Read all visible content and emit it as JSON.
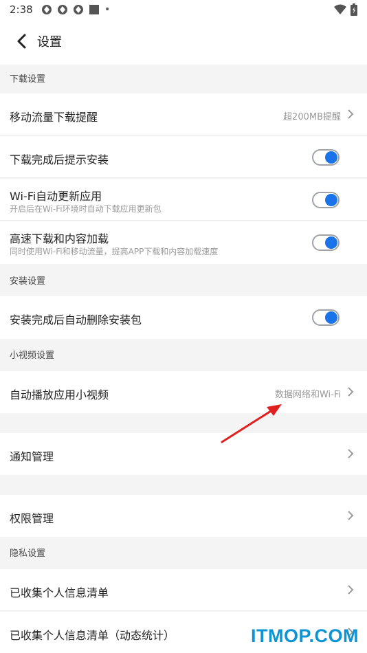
{
  "statusbar": {
    "time": "2:38",
    "dot": "•"
  },
  "appbar": {
    "title": "设置",
    "back_icon": "chevron-left-icon"
  },
  "sections": {
    "download": "下载设置",
    "install": "安装设置",
    "video": "小视频设置",
    "privacy": "隐私设置"
  },
  "rows": {
    "mobile_data": {
      "label": "移动流量下载提醒",
      "value": "超200MB提醒"
    },
    "install_prompt": {
      "label": "下载完成后提示安装",
      "toggle": true
    },
    "wifi_update": {
      "label": "Wi-Fi自动更新应用",
      "sub": "开启后在Wi-Fi环境时自动下载应用更新包",
      "toggle": true
    },
    "high_speed": {
      "label": "高速下载和内容加载",
      "sub": "同时使用Wi-Fi和移动流量，提高APP下载和内容加载速度",
      "toggle": true
    },
    "auto_delete": {
      "label": "安装完成后自动删除安装包",
      "toggle": true
    },
    "autoplay": {
      "label": "自动播放应用小视频",
      "value": "数据网络和Wi-Fi"
    },
    "notify": {
      "label": "通知管理"
    },
    "permission": {
      "label": "权限管理"
    },
    "collected": {
      "label": "已收集个人信息清单"
    },
    "collected_dynamic": {
      "label": "已收集个人信息清单（动态统计）"
    }
  },
  "watermark": "ITMOP.COM",
  "colors": {
    "accent": "#1a73e8",
    "annotation": "#e02020",
    "watermark": "#0e94d4"
  }
}
